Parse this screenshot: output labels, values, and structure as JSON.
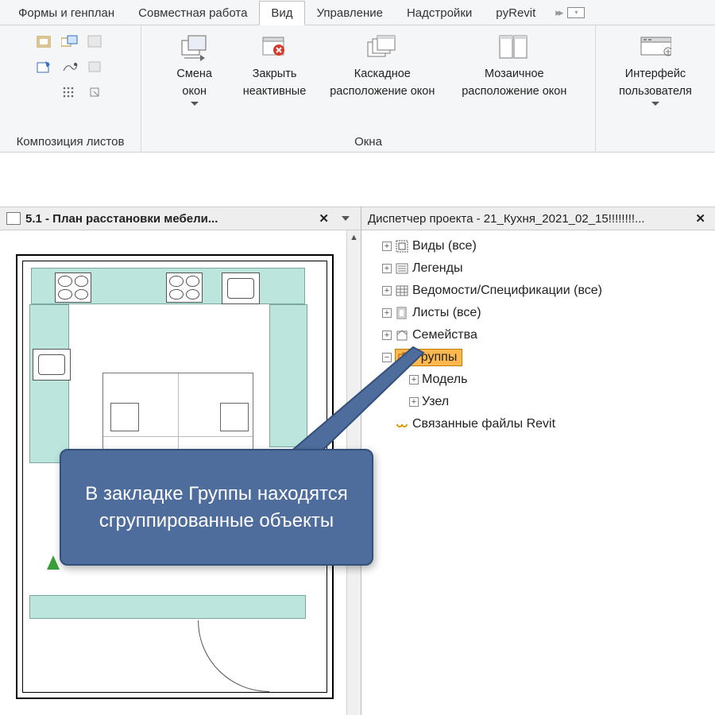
{
  "ribbon_tabs": {
    "forms": "Формы и генплан",
    "collab": "Совместная работа",
    "view": "Вид",
    "manage": "Управление",
    "addins": "Надстройки",
    "pyrevit": "pyRevit"
  },
  "panels": {
    "sheets": {
      "label": "Композиция листов"
    },
    "windows": {
      "label": "Окна",
      "switch_l1": "Смена",
      "switch_l2": "окон",
      "close_l1": "Закрыть",
      "close_l2": "неактивные",
      "cascade_l1": "Каскадное",
      "cascade_l2": "расположение окон",
      "tile_l1": "Мозаичное",
      "tile_l2": "расположение окон"
    },
    "ui": {
      "label_l1": "Интерфейс",
      "label_l2": "пользователя"
    }
  },
  "left_pane": {
    "title": "5.1 - План расстановки мебели..."
  },
  "browser": {
    "title": "Диспетчер проекта - 21_Кухня_2021_02_15!!!!!!!!...",
    "views": "Виды (все)",
    "legends": "Легенды",
    "schedules": "Ведомости/Спецификации (все)",
    "sheets": "Листы (все)",
    "families": "Семейства",
    "groups": "Группы",
    "model": "Модель",
    "detail": "Узел",
    "links": "Связанные файлы Revit"
  },
  "callout": {
    "text": "В закладке Группы находятся сгруппированные объекты"
  }
}
